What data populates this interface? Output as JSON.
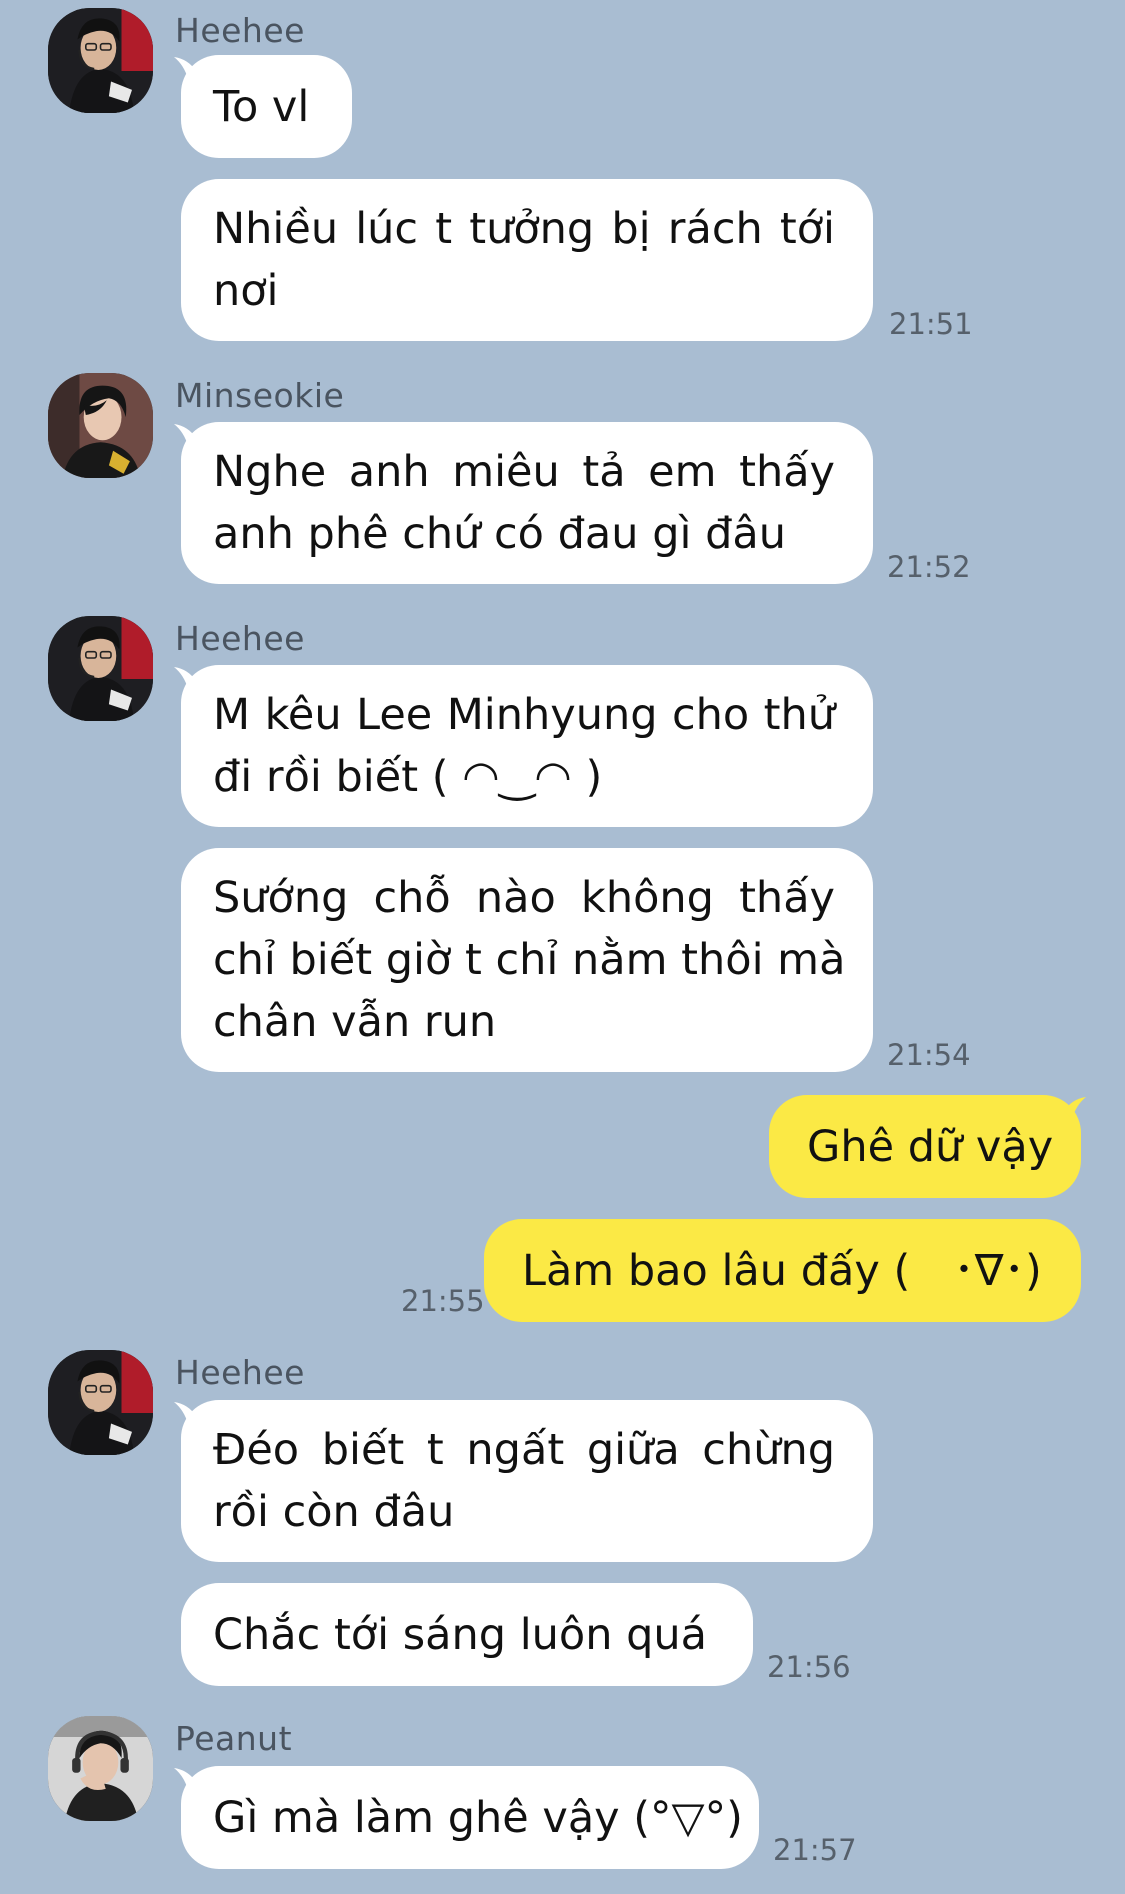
{
  "colors": {
    "background": "#a9bdd2",
    "incoming_bubble": "#ffffff",
    "outgoing_bubble": "#fbe945",
    "timestamp": "#56606b"
  },
  "messages": [
    {
      "sender": "Heehee",
      "avatar": "avatar-heehee",
      "bubbles": [
        {
          "lines": [
            "To vl"
          ]
        },
        {
          "lines": [
            "Nhiều lúc t tưởng bị rách tới",
            "nơi"
          ]
        }
      ],
      "time": "21:51"
    },
    {
      "sender": "Minseokie",
      "avatar": "avatar-minseokie",
      "bubbles": [
        {
          "lines": [
            "Nghe anh miêu tả em thấy",
            "anh phê chứ có đau gì đâu"
          ]
        }
      ],
      "time": "21:52"
    },
    {
      "sender": "Heehee",
      "avatar": "avatar-heehee",
      "bubbles": [
        {
          "lines": [
            "M kêu Lee Minhyung cho thử",
            "đi rồi biết ( ◠‿◠ )"
          ]
        },
        {
          "lines": [
            "Sướng chỗ nào không thấy",
            "chỉ biết giờ t chỉ nằm thôi mà",
            "chân vẫn run"
          ]
        }
      ],
      "time": "21:54"
    },
    {
      "sender": "",
      "outgoing": true,
      "bubbles": [
        {
          "lines": [
            "Ghê dữ vậy"
          ]
        },
        {
          "lines": [
            "Làm bao lâu đấy (　･∇･)"
          ]
        }
      ],
      "time": "21:55"
    },
    {
      "sender": "Heehee",
      "avatar": "avatar-heehee",
      "bubbles": [
        {
          "lines": [
            "Đéo biết t ngất giữa chừng",
            "rồi còn đâu"
          ]
        },
        {
          "lines": [
            "Chắc tới sáng luôn quá"
          ]
        }
      ],
      "time": "21:56"
    },
    {
      "sender": "Peanut",
      "avatar": "avatar-peanut",
      "bubbles": [
        {
          "lines": [
            "Gì mà làm ghê vậy (°▽°)"
          ]
        }
      ],
      "time": "21:57"
    }
  ]
}
